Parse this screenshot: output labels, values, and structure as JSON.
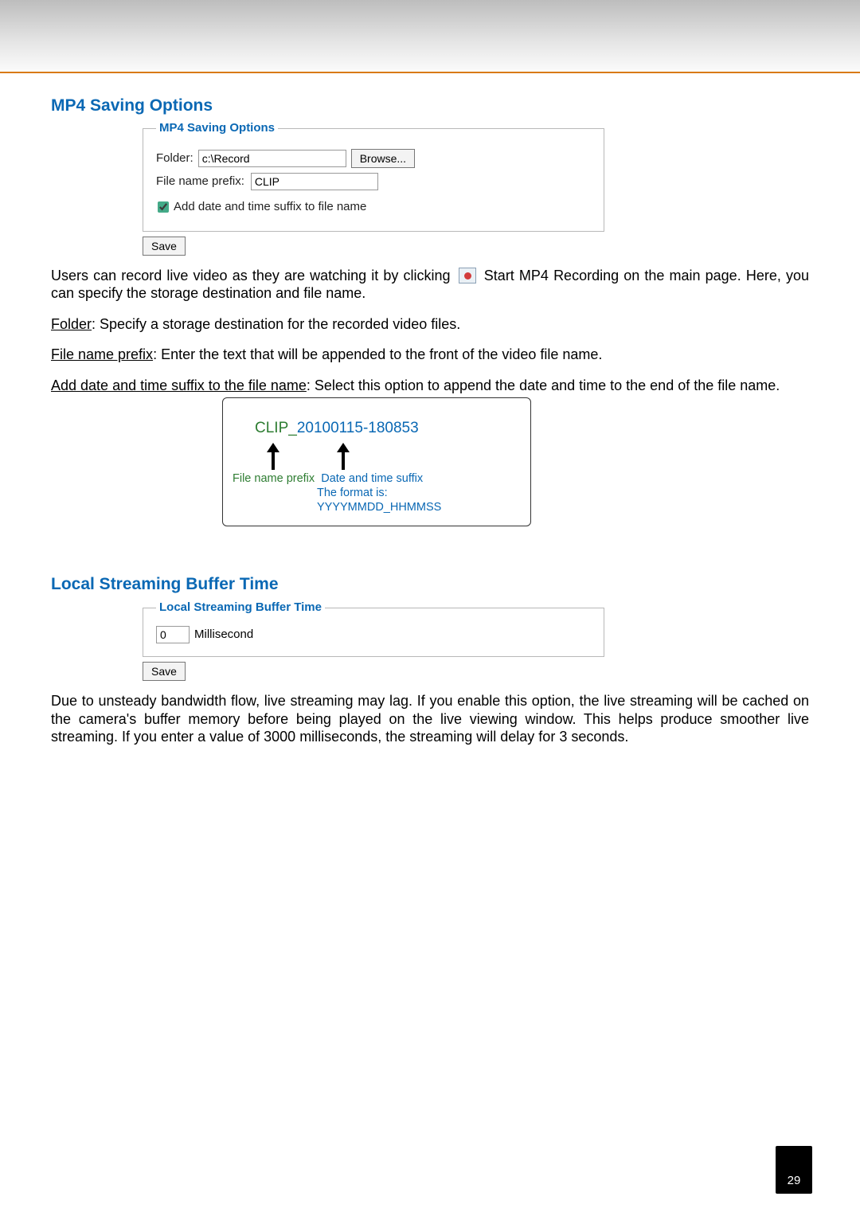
{
  "page_number": "29",
  "s1": {
    "heading": "MP4 Saving Options",
    "panel_legend": "MP4 Saving Options",
    "folder_label": "Folder:",
    "folder_value": "c:\\Record",
    "browse_label": "Browse...",
    "prefix_label": "File name prefix:",
    "prefix_value": "CLIP",
    "checkbox_label": "Add date and time suffix to file name",
    "save_label": "Save",
    "para1_a": "Users can record live video as they are watching it by clicking",
    "para1_b": "Start MP4 Recording on the main page. Here, you can specify the storage destination and file name.",
    "folder_desc_label": "Folder",
    "folder_desc": ": Specify a storage destination for the recorded video files.",
    "prefix_desc_label": "File name prefix",
    "prefix_desc": ": Enter the text that will be appended to the front of the video file name.",
    "suffix_desc_label": "Add date and time suffix to the file name",
    "suffix_desc": ": Select this option to append the date and time to the end of the file name.",
    "example_clip": "CLIP_",
    "example_suffix": "20100115-180853",
    "example_prefix_cap": "File name prefix",
    "example_suffix_cap": "Date and time suffix",
    "example_format": "The format is: YYYYMMDD_HHMMSS"
  },
  "s2": {
    "heading": "Local Streaming Buffer Time",
    "panel_legend": "Local Streaming Buffer Time",
    "buffer_value": "0",
    "buffer_unit": "Millisecond",
    "save_label": "Save",
    "para": "Due to unsteady bandwidth flow, live streaming may lag. If you enable this option, the live streaming will be cached on the camera's buffer memory before being played on the live viewing window. This helps produce smoother live streaming. If you enter a value of 3000 milliseconds, the streaming will delay for 3 seconds."
  }
}
